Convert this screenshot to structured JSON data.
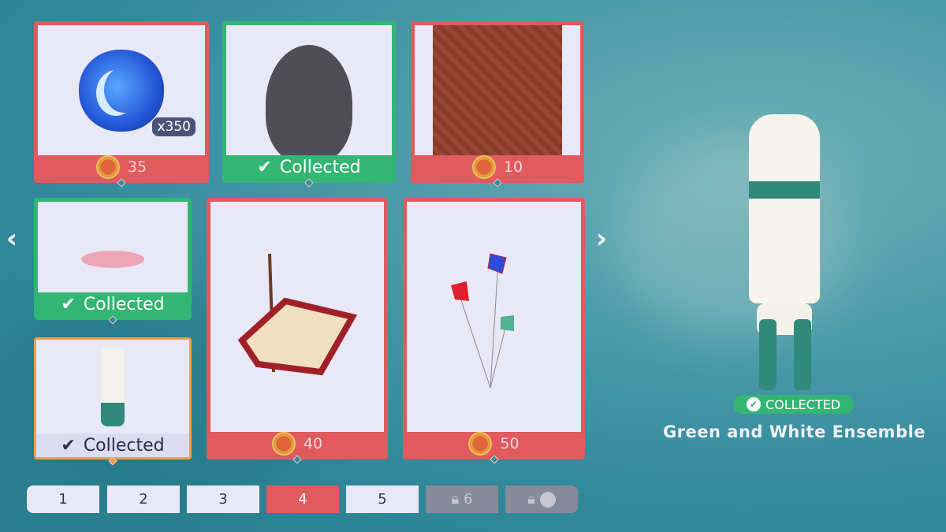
{
  "cards": [
    {
      "type": "currency",
      "qty": "x350",
      "price": "35",
      "status": "price"
    },
    {
      "type": "face",
      "label": "Collected",
      "status": "collected"
    },
    {
      "type": "pattern",
      "price": "10",
      "status": "price"
    },
    {
      "type": "petals",
      "label": "Collected",
      "status": "collected"
    },
    {
      "type": "outfit",
      "label": "Collected",
      "status": "selected"
    },
    {
      "type": "tent",
      "price": "40",
      "status": "price"
    },
    {
      "type": "kites",
      "price": "50",
      "status": "price"
    }
  ],
  "pagination": [
    {
      "label": "1"
    },
    {
      "label": "2"
    },
    {
      "label": "3"
    },
    {
      "label": "4",
      "active": true
    },
    {
      "label": "5"
    },
    {
      "label": "6",
      "locked": true
    },
    {
      "label": "",
      "locked": true,
      "icon": "moon-icon"
    }
  ],
  "preview": {
    "badge": "COLLECTED",
    "name": "Green and White Ensemble"
  },
  "colors": {
    "price": "#e05a5e",
    "collected": "#33b573",
    "selected": "#f0a04a"
  }
}
